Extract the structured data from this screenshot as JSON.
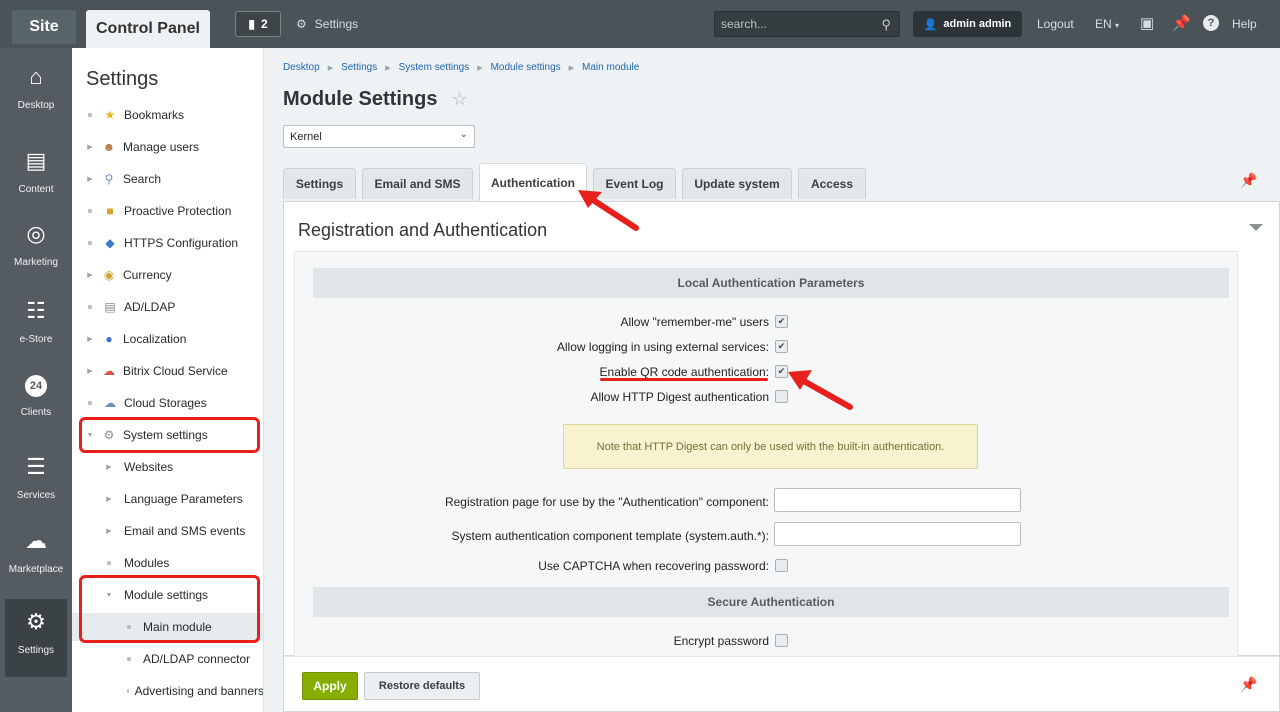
{
  "topbar": {
    "site": "Site",
    "control_panel": "Control Panel",
    "notifications_count": "2",
    "settings_label": "Settings",
    "search_placeholder": "search...",
    "user": "admin admin",
    "logout": "Logout",
    "lang": "EN",
    "help": "Help"
  },
  "leftnav": {
    "items": [
      {
        "label": "Desktop",
        "icon": "home-icon"
      },
      {
        "label": "Content",
        "icon": "document-icon"
      },
      {
        "label": "Marketing",
        "icon": "target-icon"
      },
      {
        "label": "e-Store",
        "icon": "basket-icon"
      },
      {
        "label": "Clients",
        "icon": "clients-24-icon"
      },
      {
        "label": "Services",
        "icon": "layers-icon"
      },
      {
        "label": "Marketplace",
        "icon": "cloud-download-icon"
      },
      {
        "label": "Settings",
        "icon": "gear-icon"
      }
    ]
  },
  "sidebar": {
    "title": "Settings",
    "items": [
      {
        "label": "Bookmarks"
      },
      {
        "label": "Manage users"
      },
      {
        "label": "Search"
      },
      {
        "label": "Proactive Protection"
      },
      {
        "label": "HTTPS Configuration"
      },
      {
        "label": "Currency"
      },
      {
        "label": "AD/LDAP"
      },
      {
        "label": "Localization"
      },
      {
        "label": "Bitrix Cloud Service"
      },
      {
        "label": "Cloud Storages"
      },
      {
        "label": "System settings"
      },
      {
        "label": "Websites"
      },
      {
        "label": "Language Parameters"
      },
      {
        "label": "Email and SMS events"
      },
      {
        "label": "Modules"
      },
      {
        "label": "Module settings"
      },
      {
        "label": "Main module"
      },
      {
        "label": "AD/LDAP connector"
      },
      {
        "label": "Advertising and banners"
      }
    ]
  },
  "breadcrumb": [
    "Desktop",
    "Settings",
    "System settings",
    "Module settings",
    "Main module"
  ],
  "page": {
    "title": "Module Settings",
    "module_select": "Kernel"
  },
  "tabs": [
    "Settings",
    "Email and SMS",
    "Authentication",
    "Event Log",
    "Update system",
    "Access"
  ],
  "panel": {
    "title": "Registration and Authentication",
    "section1": "Local Authentication Parameters",
    "rows": [
      {
        "label": "Allow \"remember-me\" users",
        "checked": true
      },
      {
        "label": "Allow logging in using external services:",
        "checked": true
      },
      {
        "label": "Enable QR code authentication:",
        "checked": true
      },
      {
        "label": "Allow HTTP Digest authentication",
        "checked": false
      }
    ],
    "note": "Note that HTTP Digest can only be used with the built-in authentication.",
    "reg_page_label": "Registration page for use by the \"Authentication\" component:",
    "template_label": "System authentication component template (system.auth.*):",
    "captcha_label": "Use CAPTCHA when recovering password:",
    "section2": "Secure Authentication",
    "encrypt_label": "Encrypt password"
  },
  "buttons": {
    "apply": "Apply",
    "restore": "Restore defaults"
  },
  "accent_colors": {
    "highlight": "#e8201c",
    "apply_green": "#86ad00"
  }
}
